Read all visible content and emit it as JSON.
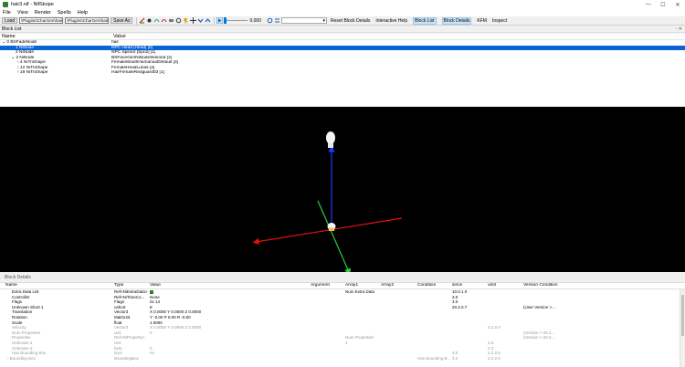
{
  "window": {
    "title": "hair3.nif - NifSkope",
    "min": "—",
    "max": "☐",
    "close": "✕"
  },
  "menu": [
    "File",
    "View",
    "Render",
    "Spells",
    "Help"
  ],
  "toolbar": {
    "load_label": "Load",
    "load_path": "\\Plugins\\CharGen\\hair3.nif",
    "save_path": "\\Plugins\\CharGen\\hair3.nif",
    "save_label": "Save As",
    "slider_value": "0.000",
    "links": [
      "Reset Block Details",
      "Interactive Help",
      "Block List",
      "Block Details",
      "KFM",
      "Inspect"
    ]
  },
  "block_list": {
    "title": "Block List",
    "columns": [
      "Name",
      "Value"
    ],
    "rows": [
      {
        "name": "⌄ 0 BSFadeNode",
        "value": "hair"
      },
      {
        "name": "1 NiNode",
        "value": "NPC Head [Head] [0]",
        "selected": true
      },
      {
        "name": "2 NiNode",
        "value": "NPC Spine2 [Spn2] [1]"
      },
      {
        "name": "⌄ 3 NiNode",
        "value": "BSFaceGenNiNodeSkinned [2]"
      },
      {
        "name": "› 4 NiTriShape",
        "value": "FemaleMouthHumanoidDefault [3]"
      },
      {
        "name": "› 12 NiTriShape",
        "value": "FemaleHeadLunas [4]"
      },
      {
        "name": "› 19 NiTriShape",
        "value": "HairFemaleRedguard03 [1]"
      }
    ]
  },
  "block_details": {
    "title": "Block Details",
    "columns": [
      "Name",
      "Type",
      "Value",
      "Argument",
      "Array1",
      "Array2",
      "Condition",
      "since",
      "until",
      "Version Condition"
    ],
    "rows": [
      {
        "name": "Extra Data List",
        "type": "Ref<NiExtraData>",
        "value": "",
        "arr1": "Num Extra Data",
        "since": "10.0.1.0"
      },
      {
        "name": "Controller",
        "type": "Ref<NiTimeCo...",
        "value": "None",
        "since": "3.0"
      },
      {
        "name": "Flags",
        "type": "Flags",
        "value": "0x 14",
        "since": "3.0"
      },
      {
        "name": "Unknown Short 1",
        "type": "ushort",
        "value": "8",
        "since": "20.2.0.7",
        "vcond": "(User Version >..."
      },
      {
        "name": "Translation",
        "type": "Vector3",
        "value": "X 0.0000 Y 0.0000 Z 0.0000"
      },
      {
        "name": "Rotation",
        "type": "Matrix33",
        "value": "Y -0.00 P 0.00 R -0.00"
      },
      {
        "name": "Scale",
        "type": "float",
        "value": "1.0000"
      },
      {
        "name": "Velocity",
        "type": "Vector3",
        "value": "X 0.0000 Y 0.0000 Z 0.0000",
        "until": "4.2.2.0",
        "dim": true
      },
      {
        "name": "Num Properties",
        "type": "uint",
        "value": "0",
        "vcond": "(Version < 20.2...",
        "dim": true
      },
      {
        "name": "Properties",
        "type": "Ref<NiProperty>",
        "value": "",
        "arr1": "Num Properties",
        "vcond": "(Version < 20.2...",
        "dim": true
      },
      {
        "name": "Unknown 1",
        "type": "uint",
        "value": "",
        "arr1": "4",
        "until": "2.3",
        "dim": true
      },
      {
        "name": "Unknown 2",
        "type": "byte",
        "value": "0",
        "until": "2.3",
        "dim": true
      },
      {
        "name": "Has Bounding Box",
        "type": "bool",
        "value": "no",
        "since": "3.0",
        "until": "4.2.2.0",
        "dim": true
      },
      {
        "name": "› Bounding Box",
        "type": "BoundingBox",
        "value": "",
        "cond": "Has Bounding B...",
        "since": "3.0",
        "until": "4.2.2.0",
        "dim": true
      }
    ]
  },
  "colors": {
    "selection": "#0a64d6",
    "x_axis": "#e01010",
    "y_axis": "#2ecc40",
    "z_axis": "#1e3cff",
    "viewport_bg": "#000000"
  }
}
